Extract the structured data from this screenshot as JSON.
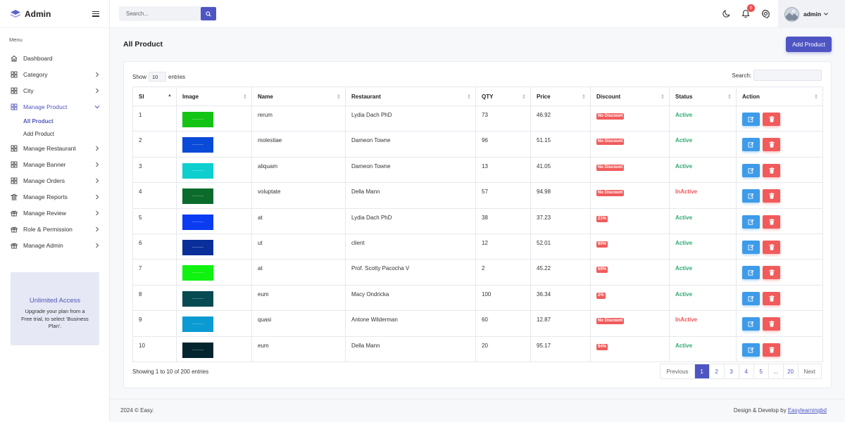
{
  "brand": {
    "name": "Admin",
    "logo_icon": "layers-icon"
  },
  "sidebar": {
    "menu_label": "Menu",
    "items": [
      {
        "label": "Dashboard",
        "icon": "home-icon",
        "has_chevron": false,
        "active": false
      },
      {
        "label": "Category",
        "icon": "grid-icon",
        "has_chevron": true,
        "active": false
      },
      {
        "label": "City",
        "icon": "grid-icon",
        "has_chevron": true,
        "active": false
      },
      {
        "label": "Manage Product",
        "icon": "grid-icon",
        "has_chevron": true,
        "active": true,
        "expanded": true,
        "children": [
          {
            "label": "All Product",
            "active": true
          },
          {
            "label": "Add Product",
            "active": false
          }
        ]
      },
      {
        "label": "Manage Restaurant",
        "icon": "grid-icon",
        "has_chevron": true,
        "active": false
      },
      {
        "label": "Manage Banner",
        "icon": "grid-icon",
        "has_chevron": true,
        "active": false
      },
      {
        "label": "Manage Orders",
        "icon": "grid-icon",
        "has_chevron": true,
        "active": false
      },
      {
        "label": "Manage Reports",
        "icon": "bank-icon",
        "has_chevron": true,
        "active": false
      },
      {
        "label": "Manage Review",
        "icon": "gift-icon",
        "has_chevron": true,
        "active": false
      },
      {
        "label": "Role & Permission",
        "icon": "gift-icon",
        "has_chevron": true,
        "active": false
      },
      {
        "label": "Manage Admin",
        "icon": "gift-icon",
        "has_chevron": true,
        "active": false
      }
    ],
    "upgrade": {
      "title": "Unlimited Access",
      "text": "Upgrade your plan from a Free trial, to select 'Business Plan'."
    }
  },
  "topbar": {
    "search_placeholder": "Search...",
    "notification_count": "0",
    "user_name": "admin"
  },
  "page": {
    "title": "All Product",
    "add_button": "Add Product"
  },
  "table_controls": {
    "show_label": "Show",
    "entries_value": "10",
    "entries_label": "entries",
    "search_label": "Search:"
  },
  "columns": [
    "Sl",
    "Image",
    "Name",
    "Restaurant",
    "QTY",
    "Price",
    "Discount",
    "Status",
    "Action"
  ],
  "rows": [
    {
      "sl": "1",
      "color": "#14c414",
      "name": "rerum",
      "restaurant": "Lydia Dach PhD",
      "qty": "73",
      "price": "46.92",
      "discount": "No Discount",
      "status": "Active"
    },
    {
      "sl": "2",
      "color": "#0a4ad8",
      "name": "molestiae",
      "restaurant": "Dameon Towne",
      "qty": "96",
      "price": "51.15",
      "discount": "No Discount",
      "status": "Active"
    },
    {
      "sl": "3",
      "color": "#0ecfcf",
      "name": "aliquam",
      "restaurant": "Dameon Towne",
      "qty": "13",
      "price": "41.05",
      "discount": "No Discount",
      "status": "Active"
    },
    {
      "sl": "4",
      "color": "#0b6b2a",
      "name": "voluptate",
      "restaurant": "Della Mann",
      "qty": "57",
      "price": "94.98",
      "discount": "No Discount",
      "status": "InActive"
    },
    {
      "sl": "5",
      "color": "#0a3cf2",
      "name": "at",
      "restaurant": "Lydia Dach PhD",
      "qty": "38",
      "price": "37.23",
      "discount": "21%",
      "status": "Active"
    },
    {
      "sl": "6",
      "color": "#0a2f9a",
      "name": "ut",
      "restaurant": "client",
      "qty": "12",
      "price": "52.01",
      "discount": "60%",
      "status": "Active"
    },
    {
      "sl": "7",
      "color": "#10f210",
      "name": "at",
      "restaurant": "Prof. Scotty Pacocha V",
      "qty": "2",
      "price": "45.22",
      "discount": "59%",
      "status": "Active"
    },
    {
      "sl": "8",
      "color": "#064a52",
      "name": "eum",
      "restaurant": "Macy Ondricka",
      "qty": "100",
      "price": "36.34",
      "discount": "2%",
      "status": "Active"
    },
    {
      "sl": "9",
      "color": "#0b9ad2",
      "name": "quasi",
      "restaurant": "Antone Wilderman",
      "qty": "60",
      "price": "12.87",
      "discount": "No Discount",
      "status": "InActive"
    },
    {
      "sl": "10",
      "color": "#04252e",
      "name": "eum",
      "restaurant": "Della Mann",
      "qty": "20",
      "price": "95.17",
      "discount": "94%",
      "status": "Active"
    }
  ],
  "pagination": {
    "showing_text": "Showing 1 to 10 of 200 entries",
    "previous": "Previous",
    "pages": [
      "1",
      "2",
      "3",
      "4",
      "5",
      "...",
      "20"
    ],
    "current": "1",
    "next": "Next"
  },
  "footer": {
    "copyright": "2024 © Easy.",
    "credit_prefix": "Design & Develop by ",
    "credit_link": "Easylearningbd"
  },
  "colors": {
    "primary": "#4e55c3",
    "active_status": "#2eaa6f",
    "inactive_status": "#f15454",
    "badge": "#f15b5b",
    "edit": "#3d9be9"
  }
}
